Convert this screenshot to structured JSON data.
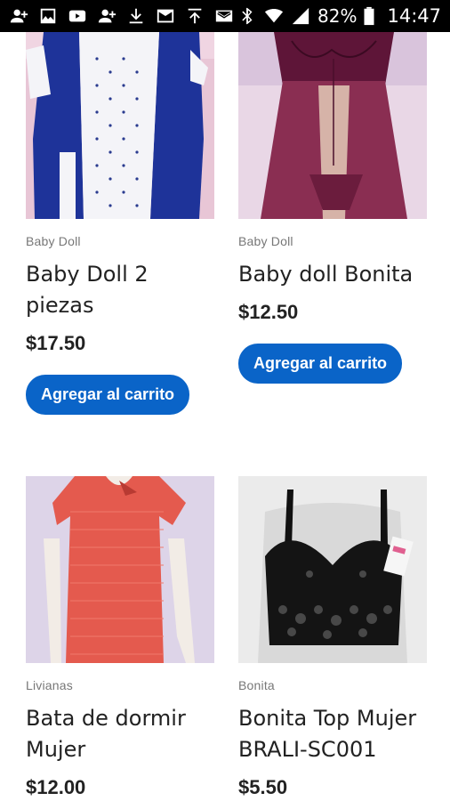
{
  "status_bar": {
    "left_icons": [
      "person-add-icon",
      "image-icon",
      "youtube-icon",
      "person-add-icon",
      "download-icon",
      "email-icon",
      "upload-icon",
      "mail-icon"
    ],
    "right_icons": [
      "bluetooth-icon",
      "wifi-icon",
      "signal-icon"
    ],
    "battery_percent": "82%",
    "time": "14:47"
  },
  "products": [
    {
      "category": "Baby Doll",
      "name": "Baby Doll 2 piezas",
      "price": "$17.50",
      "button_label": "Agregar al carrito",
      "image_icon": "blue-robe-photo"
    },
    {
      "category": "Baby Doll",
      "name": "Baby doll Bonita",
      "price": "$12.50",
      "button_label": "Agregar al carrito",
      "image_icon": "burgundy-babydoll-photo"
    },
    {
      "category": "Livianas",
      "name": "Bata de dormir Mujer",
      "price": "$12.00",
      "image_icon": "red-nightgown-photo"
    },
    {
      "category": "Bonita",
      "name": "Bonita Top Mujer BRALI-SC001",
      "price": "$5.50",
      "image_icon": "black-lace-bra-photo"
    }
  ],
  "colors": {
    "button_bg": "#0a64c8",
    "status_bar_bg": "#000000"
  }
}
